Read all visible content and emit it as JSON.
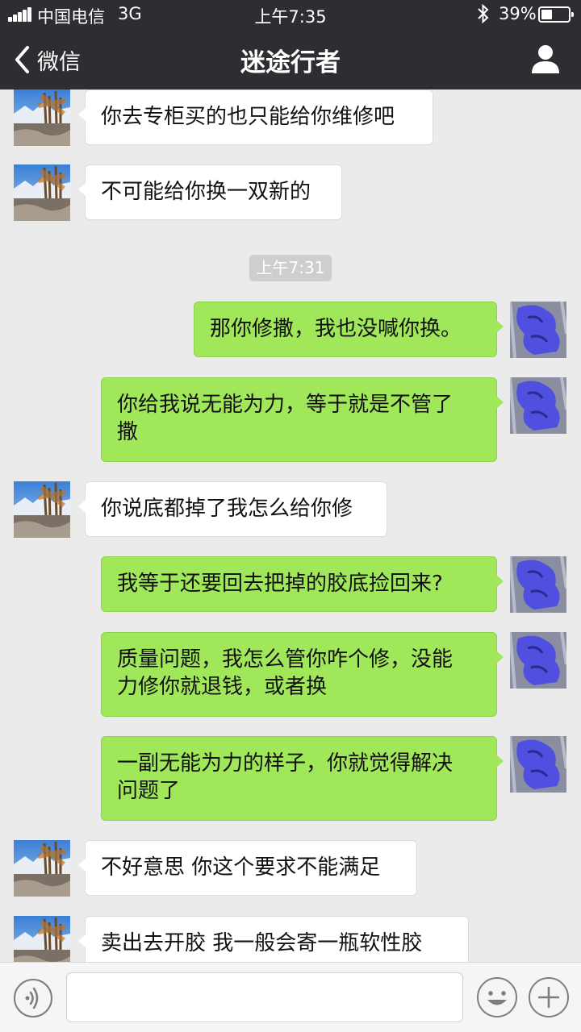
{
  "status_bar": {
    "carrier": "中国电信",
    "network": "3G",
    "time": "上午7:35",
    "battery": "39%"
  },
  "nav": {
    "back_label": "微信",
    "title": "迷途行者"
  },
  "messages": [
    {
      "side": "left",
      "text": "你去专柜买的也只能给你维修吧"
    },
    {
      "side": "left",
      "text": "不可能给你换一双新的"
    },
    {
      "side": "right",
      "text": "那你修撒，我也没喊你换。"
    },
    {
      "side": "right",
      "text": "你给我说无能为力，等于就是不管了\n撒"
    },
    {
      "side": "left",
      "text": "你说底都掉了我怎么给你修"
    },
    {
      "side": "right",
      "text": "我等于还要回去把掉的胶底捡回来?"
    },
    {
      "side": "right",
      "text": "质量问题，我怎么管你咋个修，没能\n力修你就退钱，或者换"
    },
    {
      "side": "right",
      "text": "一副无能为力的样子，你就觉得解决\n问题了"
    },
    {
      "side": "left",
      "text": "不好意思 你这个要求不能满足"
    },
    {
      "side": "left",
      "text": "卖出去开胶 我一般会寄一瓶软性胶"
    }
  ],
  "timestamp": "上午7:31",
  "input": {
    "value": "",
    "placeholder": ""
  },
  "colors": {
    "nav_bg": "#2e2e32",
    "chat_bg": "#ebebeb",
    "bubble_mine": "#a0e75a",
    "bubble_theirs": "#ffffff"
  }
}
